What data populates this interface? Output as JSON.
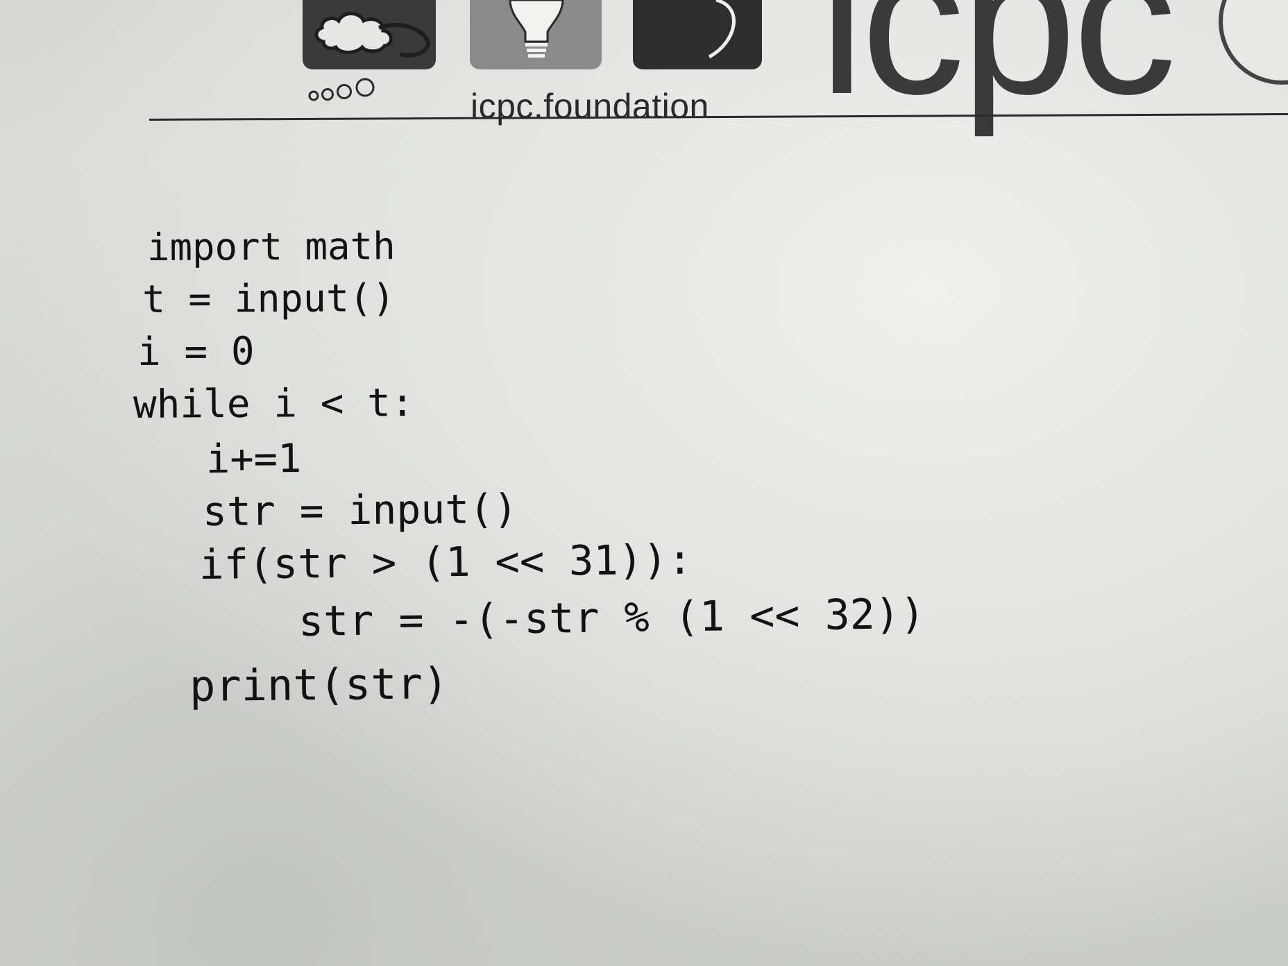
{
  "header": {
    "site": "icpc.foundation",
    "wordmark": "icpc"
  },
  "code": {
    "lines": [
      "import math",
      "t = input()",
      "i = 0",
      "while i < t:",
      "i+=1",
      "str = input()",
      "if(str > (1 << 31)):",
      "str = -(-str % (1 << 32))",
      "print(str)"
    ]
  },
  "colors": {
    "paper": "#e2e3e1",
    "ink": "#121212",
    "logo_dark": "#3a3a3a",
    "logo_mid": "#8a8a8a"
  }
}
